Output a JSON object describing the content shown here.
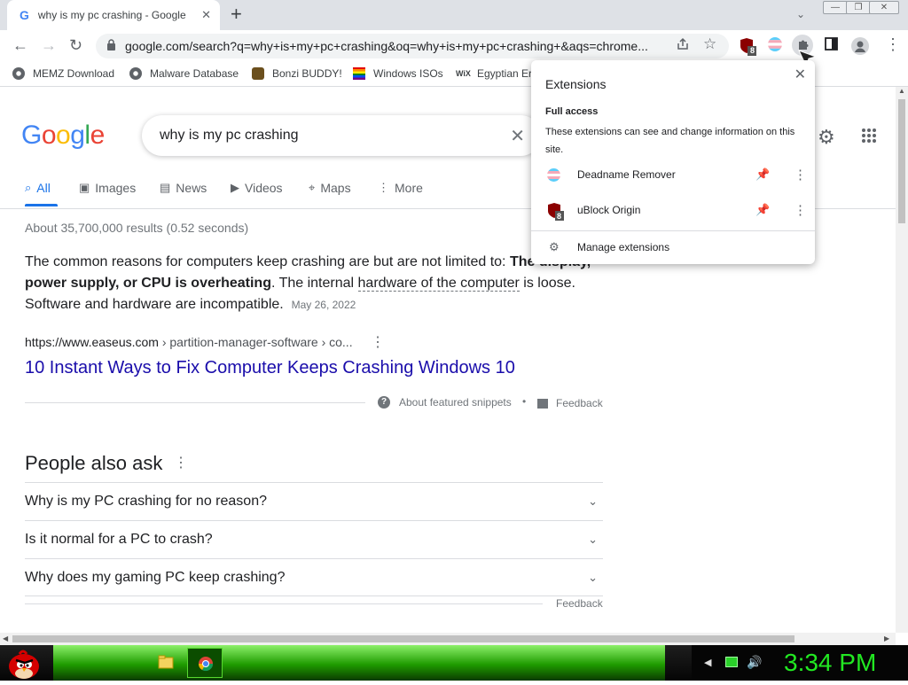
{
  "tab": {
    "title": "why is my pc crashing - Google S",
    "favicon_text": "G",
    "close": "✕",
    "new_tab": "+"
  },
  "window_buttons": {
    "minimize": "—",
    "restore": "❐",
    "close": "✕"
  },
  "toolbar": {
    "back": "←",
    "forward": "→",
    "reload": "↻",
    "lock": "🔒",
    "url": "google.com/search?q=why+is+my+pc+crashing&oq=why+is+my+pc+crashing+&aqs=chrome...",
    "ublock_badge": "8"
  },
  "bookmarks": [
    {
      "label": "MEMZ Download",
      "icon": "globe-icon"
    },
    {
      "label": "Malware Database",
      "icon": "globe-icon"
    },
    {
      "label": "Bonzi BUDDY!",
      "icon": "bonzi-icon"
    },
    {
      "label": "Windows ISOs",
      "icon": "windows-flag-icon"
    },
    {
      "label": "Egyptian Er",
      "icon": "wix-icon",
      "icon_text": "WiX"
    }
  ],
  "search": {
    "query": "why is my pc crashing",
    "clear": "✕"
  },
  "logo": {
    "letters": [
      "G",
      "o",
      "o",
      "g",
      "l",
      "e"
    ],
    "colors": [
      "#4285f4",
      "#ea4335",
      "#fbbc05",
      "#4285f4",
      "#34a853",
      "#ea4335"
    ]
  },
  "nav_tabs": [
    {
      "label": "All",
      "icon": "⌕"
    },
    {
      "label": "Images",
      "icon": "▣"
    },
    {
      "label": "News",
      "icon": "▤"
    },
    {
      "label": "Videos",
      "icon": "▶"
    },
    {
      "label": "Maps",
      "icon": "⌖"
    },
    {
      "label": "More",
      "icon": "⋮"
    }
  ],
  "results_stats": "About 35,700,000 results (0.52 seconds)",
  "snippet": {
    "text_1": "The common reasons for computers keep crashing are but are not limited to: ",
    "bold_1": "The display, power supply, or CPU is overheating",
    "text_2": ". The internal ",
    "underlined": "hardware of the computer",
    "text_3": " is loose. Software and hardware are incompatible.",
    "date": "May 26, 2022"
  },
  "result": {
    "cite_domain": "https://www.easeus.com",
    "cite_path": " › partition-manager-software › co...",
    "title": "10 Instant Ways to Fix Computer Keeps Crashing Windows 10"
  },
  "snippet_footer": {
    "about": "About featured snippets",
    "sep": "•",
    "feedback": "Feedback"
  },
  "people_also_ask": {
    "heading": "People also ask",
    "questions": [
      "Why is my PC crashing for no reason?",
      "Is it normal for a PC to crash?",
      "Why does my gaming PC keep crashing?"
    ],
    "feedback": "Feedback"
  },
  "extensions_popup": {
    "title": "Extensions",
    "section": "Full access",
    "description": "These extensions can see and change information on this site.",
    "items": [
      {
        "name": "Deadname Remover",
        "icon": "trans-flag-icon",
        "pinned": true
      },
      {
        "name": "uBlock Origin",
        "icon": "ublock-icon",
        "pinned": true
      }
    ],
    "manage": "Manage extensions"
  },
  "taskbar": {
    "clock": "3:34 PM"
  }
}
